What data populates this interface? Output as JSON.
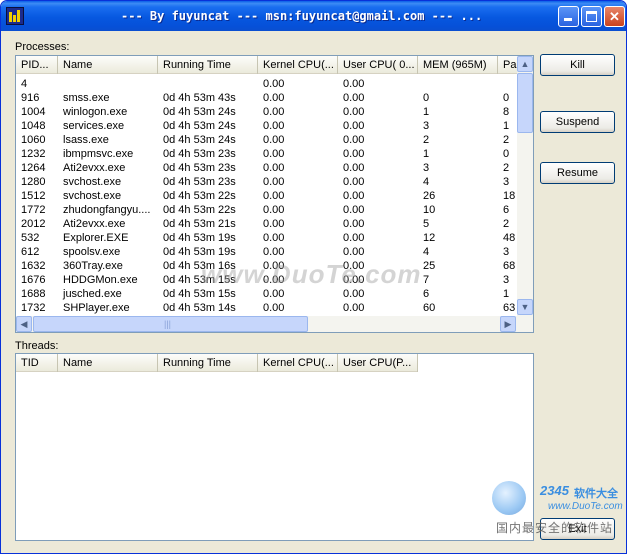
{
  "window": {
    "title": "--- By fuyuncat --- msn:fuyuncat@gmail.com --- ...",
    "minimize_label": "_",
    "close_label": "✕"
  },
  "processes": {
    "label": "Processes:",
    "columns": [
      "PID...",
      "Name",
      "Running Time",
      "Kernel CPU(...",
      "User CPU( 0...",
      "MEM (965M)",
      "Pa"
    ],
    "rows": [
      [
        "4",
        "",
        "",
        "0.00",
        "0.00",
        "",
        ""
      ],
      [
        "916",
        "smss.exe",
        "0d 4h 53m 43s",
        "0.00",
        "0.00",
        "0",
        "0"
      ],
      [
        "1004",
        "winlogon.exe",
        "0d 4h 53m 24s",
        "0.00",
        "0.00",
        "1",
        "8"
      ],
      [
        "1048",
        "services.exe",
        "0d 4h 53m 24s",
        "0.00",
        "0.00",
        "3",
        "1"
      ],
      [
        "1060",
        "lsass.exe",
        "0d 4h 53m 24s",
        "0.00",
        "0.00",
        "2",
        "2"
      ],
      [
        "1232",
        "ibmpmsvc.exe",
        "0d 4h 53m 23s",
        "0.00",
        "0.00",
        "1",
        "0"
      ],
      [
        "1264",
        "Ati2evxx.exe",
        "0d 4h 53m 23s",
        "0.00",
        "0.00",
        "3",
        "2"
      ],
      [
        "1280",
        "svchost.exe",
        "0d 4h 53m 23s",
        "0.00",
        "0.00",
        "4",
        "3"
      ],
      [
        "1512",
        "svchost.exe",
        "0d 4h 53m 22s",
        "0.00",
        "0.00",
        "26",
        "18"
      ],
      [
        "1772",
        "zhudongfangyu....",
        "0d 4h 53m 22s",
        "0.00",
        "0.00",
        "10",
        "6"
      ],
      [
        "2012",
        "Ati2evxx.exe",
        "0d 4h 53m 21s",
        "0.00",
        "0.00",
        "5",
        "2"
      ],
      [
        "532",
        "Explorer.EXE",
        "0d 4h 53m 19s",
        "0.00",
        "0.00",
        "12",
        "48"
      ],
      [
        "612",
        "spoolsv.exe",
        "0d 4h 53m 19s",
        "0.00",
        "0.00",
        "4",
        "3"
      ],
      [
        "1632",
        "360Tray.exe",
        "0d 4h 53m 16s",
        "0.00",
        "0.00",
        "25",
        "68"
      ],
      [
        "1676",
        "HDDGMon.exe",
        "0d 4h 53m 15s",
        "0.00",
        "0.00",
        "7",
        "3"
      ],
      [
        "1688",
        "jusched.exe",
        "0d 4h 53m 15s",
        "0.00",
        "0.00",
        "6",
        "1"
      ],
      [
        "1732",
        "SHPlayer.exe",
        "0d 4h 53m 14s",
        "0.00",
        "0.00",
        "60",
        "63"
      ]
    ]
  },
  "threads": {
    "label": "Threads:",
    "columns": [
      "TID",
      "Name",
      "Running Time",
      "Kernel CPU(...",
      "User CPU(P..."
    ]
  },
  "buttons": {
    "kill": "Kill",
    "suspend": "Suspend",
    "resume": "Resume",
    "exit": "Exit"
  },
  "watermark": {
    "site": "www.DuoTe.com",
    "logo_number": "2345",
    "logo_text": "软件大全",
    "logo_url": "www.DuoTe.com",
    "logo_tagline": "国内最安全的软件站"
  }
}
